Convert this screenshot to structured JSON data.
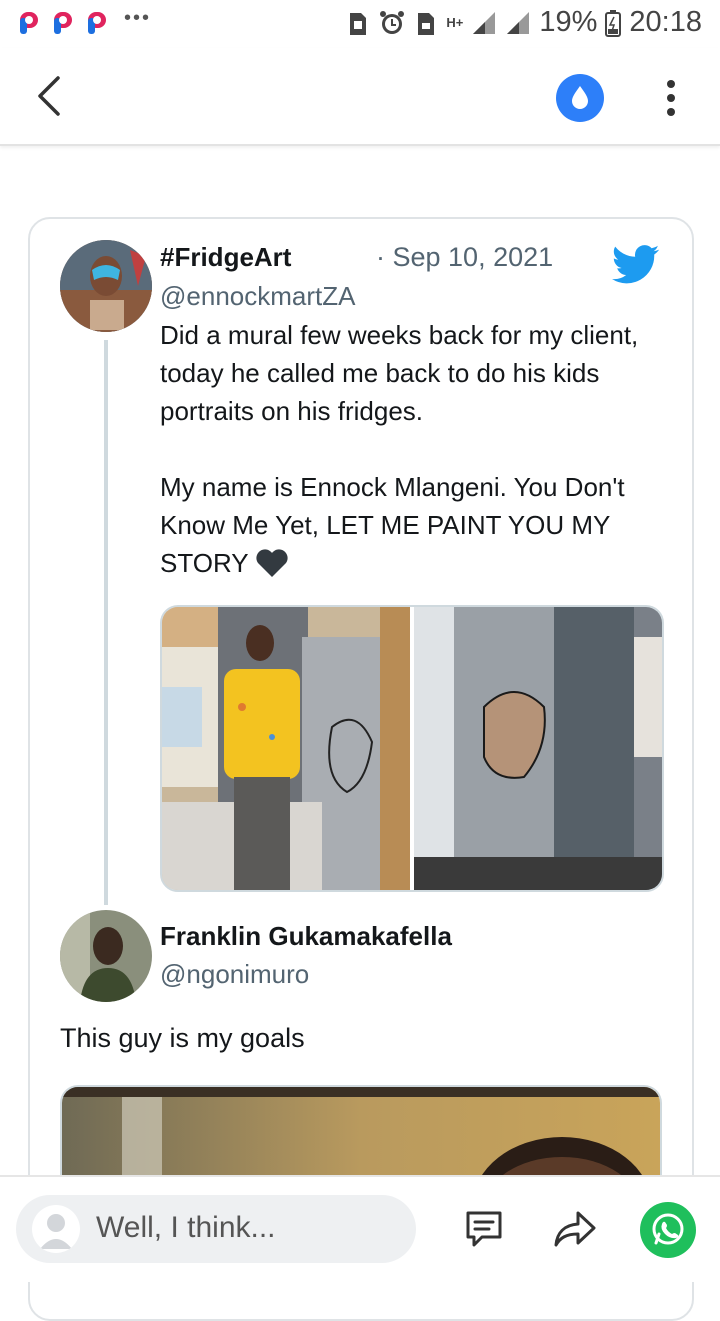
{
  "status_bar": {
    "battery": "19%",
    "time": "20:18",
    "network": "H+"
  },
  "app_bar": {
    "back_icon": "chevron-left-icon",
    "drop_icon": "water-drop-icon",
    "menu_icon": "more-vert-icon"
  },
  "tweet": {
    "author_name": "#FridgeArt",
    "date": "· Sep 10, 2021",
    "handle": "@ennockmartZA",
    "text": "Did a mural few weeks back for my client, today he called me back to do his kids portraits on his fridges.\n\nMy name is Ennock Mlangeni. You Don't Know Me Yet, LET ME PAINT YOU MY STORY",
    "emoji": "black-heart-icon",
    "brand_icon": "twitter-bird-icon"
  },
  "reply": {
    "author_name": "Franklin Gukamakafella",
    "handle": "@ngonimuro",
    "text": "This guy is my goals"
  },
  "bottom_bar": {
    "comment_placeholder": "Well, I think...",
    "comment_icon": "comment-icon",
    "share_icon": "share-icon",
    "whatsapp_icon": "whatsapp-icon"
  },
  "colors": {
    "accent_blue": "#2d7ff9",
    "twitter_blue": "#1d9bf0",
    "whatsapp_green": "#1fbf5c",
    "app_pink": "#e0245e"
  }
}
